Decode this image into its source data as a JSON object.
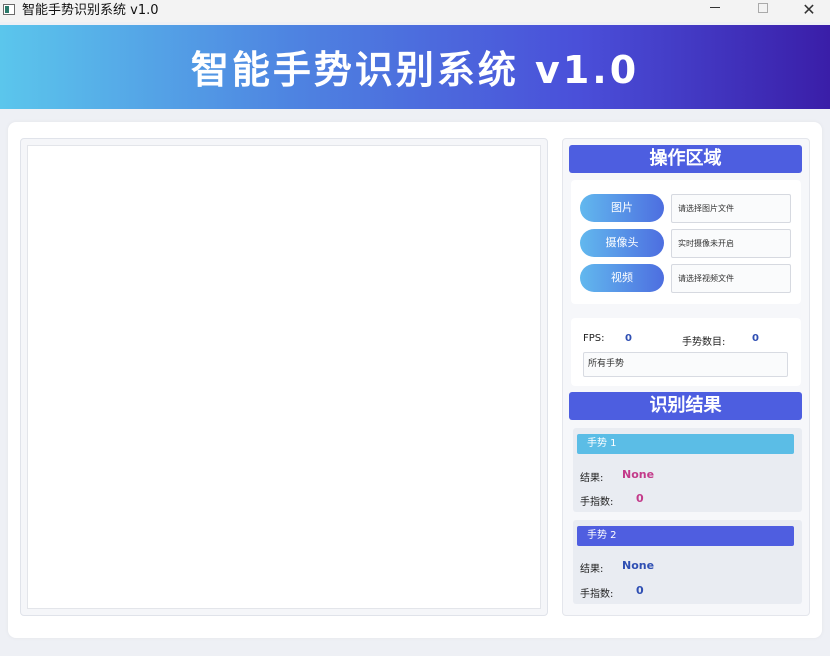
{
  "window": {
    "title": "智能手势识别系统 v1.0",
    "minimize": "",
    "maximize": "",
    "close": "✕"
  },
  "banner": {
    "title": "智能手势识别系统 v1.0"
  },
  "operation": {
    "header": "操作区域",
    "items": [
      {
        "button": "图片",
        "field": "请选择图片文件"
      },
      {
        "button": "摄像头",
        "field": "实时摄像未开启"
      },
      {
        "button": "视频",
        "field": "请选择视频文件"
      }
    ]
  },
  "stats": {
    "fps_label": "FPS:",
    "fps_value": "0",
    "count_label": "手势数目:",
    "count_value": "0",
    "all_gestures": "所有手势"
  },
  "results": {
    "header": "识别结果",
    "gestures": [
      {
        "title": "手势 1",
        "result_label": "结果:",
        "result_value": "None",
        "fingers_label": "手指数:",
        "fingers_value": "0",
        "color": "#c33a8a"
      },
      {
        "title": "手势 2",
        "result_label": "结果:",
        "result_value": "None",
        "fingers_label": "手指数:",
        "fingers_value": "0",
        "color": "#2f4fb3"
      }
    ]
  },
  "colors": {
    "accent": "#4d5ee0",
    "gesture1": "#5bbde6",
    "gesture2": "#4f5ee0"
  }
}
